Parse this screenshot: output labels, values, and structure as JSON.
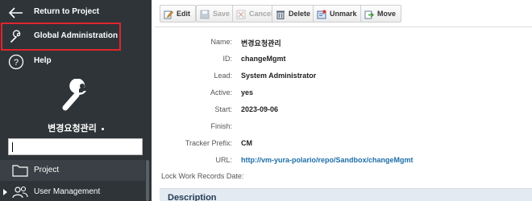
{
  "sidebar": {
    "return_label": "Return to Project",
    "admin_label": "Global Administration",
    "help_label": "Help",
    "project_title": "변경요청관리",
    "search_value": "",
    "tree": [
      {
        "label": "Project",
        "icon": "folder-icon"
      },
      {
        "label": "User Management",
        "icon": "users-icon"
      }
    ]
  },
  "toolbar": {
    "buttons": [
      {
        "label": "Edit",
        "icon": "edit-icon",
        "enabled": true
      },
      {
        "label": "Save",
        "icon": "save-icon",
        "enabled": false
      },
      {
        "label": "Cancel",
        "icon": "cancel-icon",
        "enabled": false
      },
      {
        "label": "Delete",
        "icon": "delete-icon",
        "enabled": true
      },
      {
        "label": "Unmark",
        "icon": "unmark-icon",
        "enabled": true
      },
      {
        "label": "Move",
        "icon": "move-icon",
        "enabled": true
      }
    ]
  },
  "project": {
    "fields": [
      {
        "key": "Name:",
        "value": "변경요청관리"
      },
      {
        "key": "ID:",
        "value": "changeMgmt"
      },
      {
        "key": "Lead:",
        "value": "System Administrator"
      },
      {
        "key": "Active:",
        "value": "yes"
      },
      {
        "key": "Start:",
        "value": "2023-09-06"
      },
      {
        "key": "Finish:",
        "value": ""
      },
      {
        "key": "Tracker Prefix:",
        "value": "CM"
      },
      {
        "key": "URL:",
        "value": "http://vm-yura-polario/repo/Sandbox/changeMgmt"
      },
      {
        "key": "Lock Work Records Date:",
        "value": ""
      }
    ]
  },
  "description_label": "Description",
  "colors": {
    "sidebar_bg": "#2e3438",
    "highlight": "#e0262d",
    "link": "#1d6ea8",
    "section_bg": "#e3eaf1"
  }
}
